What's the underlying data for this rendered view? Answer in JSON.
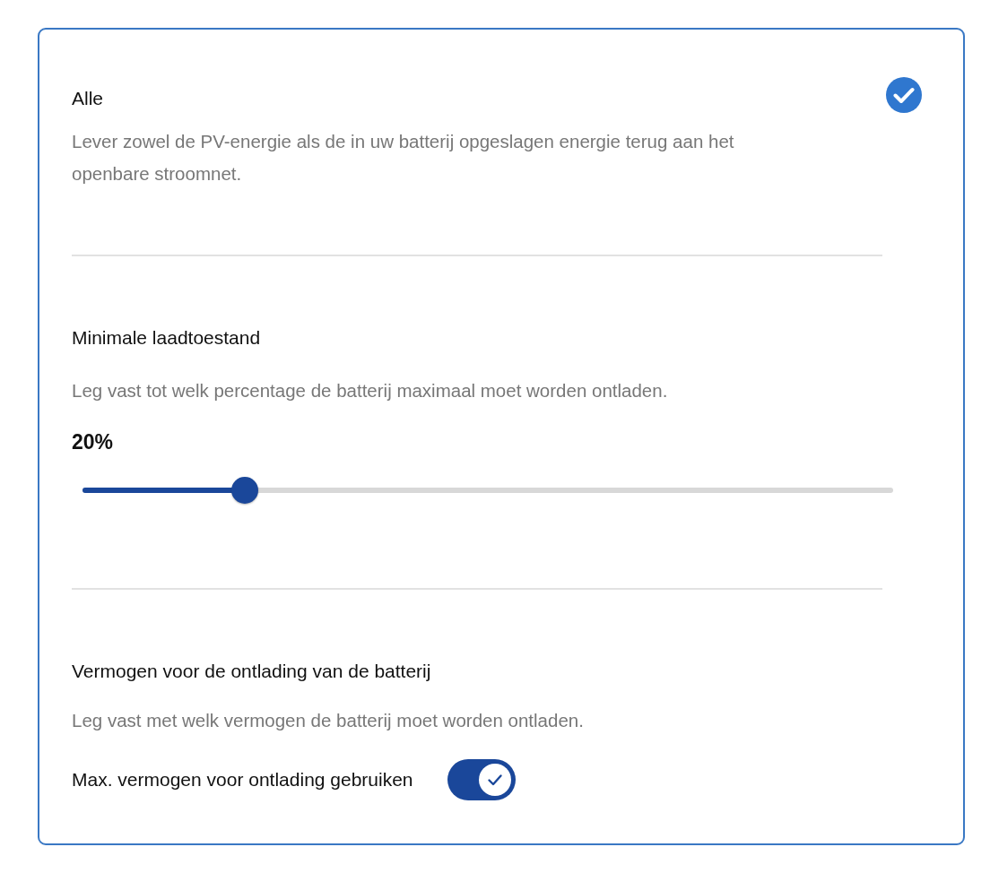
{
  "sections": [
    {
      "kind": "option",
      "title": "Alle",
      "description": "Lever zowel de PV-energie als de in uw batterij opgeslagen energie terug aan het openbare stroomnet.",
      "selected": true
    },
    {
      "kind": "slider",
      "title": "Minimale laadtoestand",
      "description": "Leg vast tot welk percentage de batterij maximaal moet worden ontladen.",
      "reading": "20%",
      "level": 0.2
    },
    {
      "kind": "toggle",
      "title": "Vermogen voor de ontlading van de batterij",
      "description": "Leg vast met welk vermogen de batterij moet worden ontladen.",
      "toggle_label": "Max. vermogen voor ontlading gebruiken",
      "on": true
    }
  ]
}
